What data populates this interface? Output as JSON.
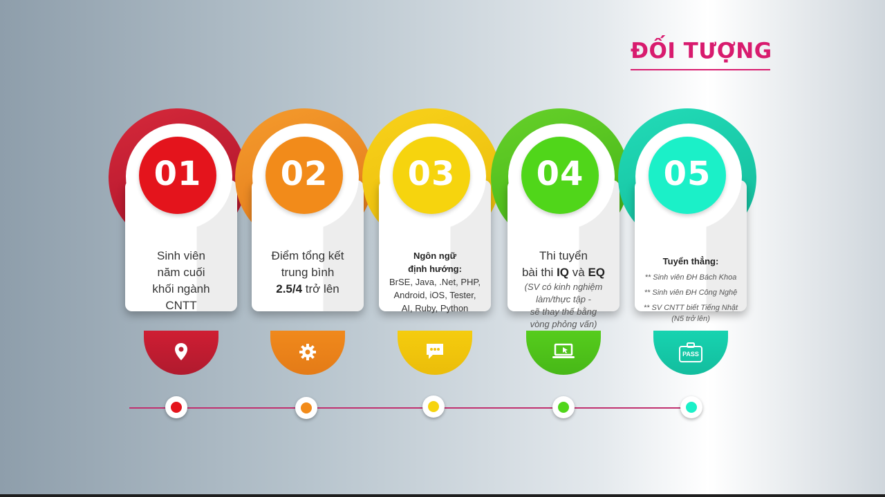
{
  "title": "ĐỐI TƯỢNG",
  "items": [
    {
      "number": "01",
      "color": "#d8142b",
      "icon": "location-pin-icon",
      "lines": [
        "Sinh viên",
        "năm cuối",
        "khối ngành",
        "CNTT"
      ]
    },
    {
      "number": "02",
      "color": "#f0891c",
      "icon": "gear-icon",
      "lines": [
        "Điểm tổng kết",
        "trung bình"
      ],
      "bold": "2.5/4",
      "bold_suffix": "trở lên"
    },
    {
      "number": "03",
      "color": "#f5cc0e",
      "icon": "chat-bubble-icon",
      "heading": [
        "Ngôn ngữ",
        "định hướng:"
      ],
      "lines": [
        "BrSE, Java, .Net, PHP,",
        "Android, iOS, Tester,",
        "AI, Ruby, Python"
      ]
    },
    {
      "number": "04",
      "color": "#56cc1d",
      "icon": "laptop-cursor-icon",
      "lines": [
        "Thi tuyển"
      ],
      "iq_prefix": "bài thi",
      "iq": "IQ",
      "iq_and": "và",
      "eq": "EQ",
      "italic": [
        "(SV có kinh nghiệm",
        "làm/thực tập -",
        "sẽ thay thế bằng",
        "vòng phỏng vấn)"
      ]
    },
    {
      "number": "05",
      "color": "#17d3b0",
      "icon": "pass-badge-icon",
      "icon_text": "PASS",
      "heading": [
        "Tuyển thẳng:"
      ],
      "lines": [
        "** Sinh viên ĐH Bách Khoa",
        "** Sinh viên ĐH Công Nghệ",
        "** SV CNTT biết Tiếng Nhật",
        "(N5 trở lên)"
      ]
    }
  ]
}
